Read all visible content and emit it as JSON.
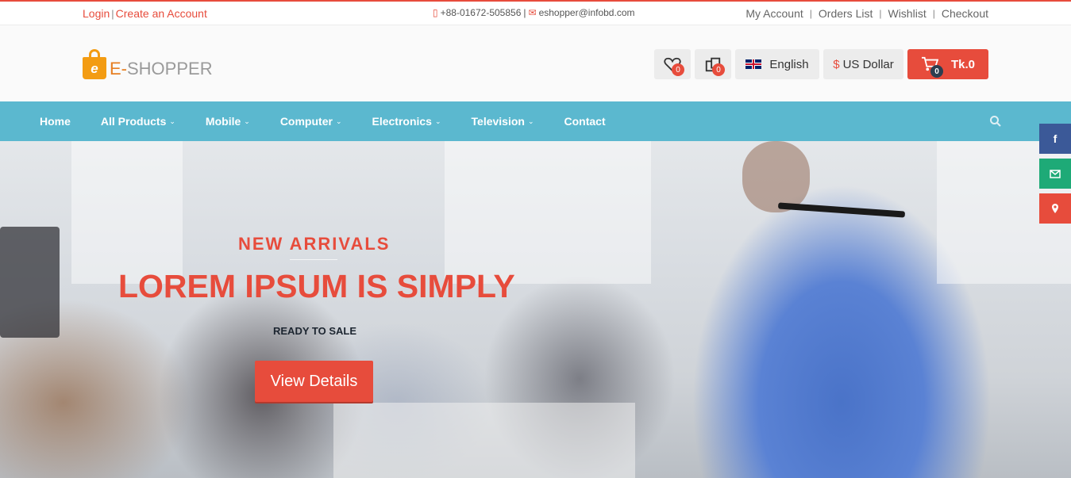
{
  "topbar": {
    "login": "Login",
    "separator": "|",
    "create_account": "Create an Account",
    "phone": "+88-01672-505856",
    "contact_separator": "|",
    "email": "eshopper@infobd.com",
    "links": [
      "My Account",
      "Orders List",
      "Wishlist",
      "Checkout"
    ],
    "link_separator": "|"
  },
  "header": {
    "logo_letter": "e",
    "logo_first": "E-",
    "logo_rest": "SHOPPER",
    "wishlist_count": "0",
    "compare_count": "0",
    "language": "English",
    "currency_symbol": "$",
    "currency": "US Dollar",
    "cart_count": "0",
    "cart_total": "Tk.0"
  },
  "nav": {
    "items": [
      {
        "label": "Home",
        "dropdown": false
      },
      {
        "label": "All Products",
        "dropdown": true
      },
      {
        "label": "Mobile",
        "dropdown": true
      },
      {
        "label": "Computer",
        "dropdown": true
      },
      {
        "label": "Electronics",
        "dropdown": true
      },
      {
        "label": "Television",
        "dropdown": true
      },
      {
        "label": "Contact",
        "dropdown": false
      }
    ]
  },
  "hero": {
    "kicker": "NEW ARRIVALS",
    "title": "LOREM IPSUM IS SIMPLY",
    "subtitle": "READY TO SALE",
    "cta": "View Details"
  },
  "social": {
    "facebook": "f",
    "email_icon": "email-icon",
    "location_icon": "map-marker-icon"
  },
  "colors": {
    "accent": "#e74c3c",
    "nav_bg": "#5bb8cf",
    "facebook": "#3b5998",
    "email": "#1eaa77"
  }
}
